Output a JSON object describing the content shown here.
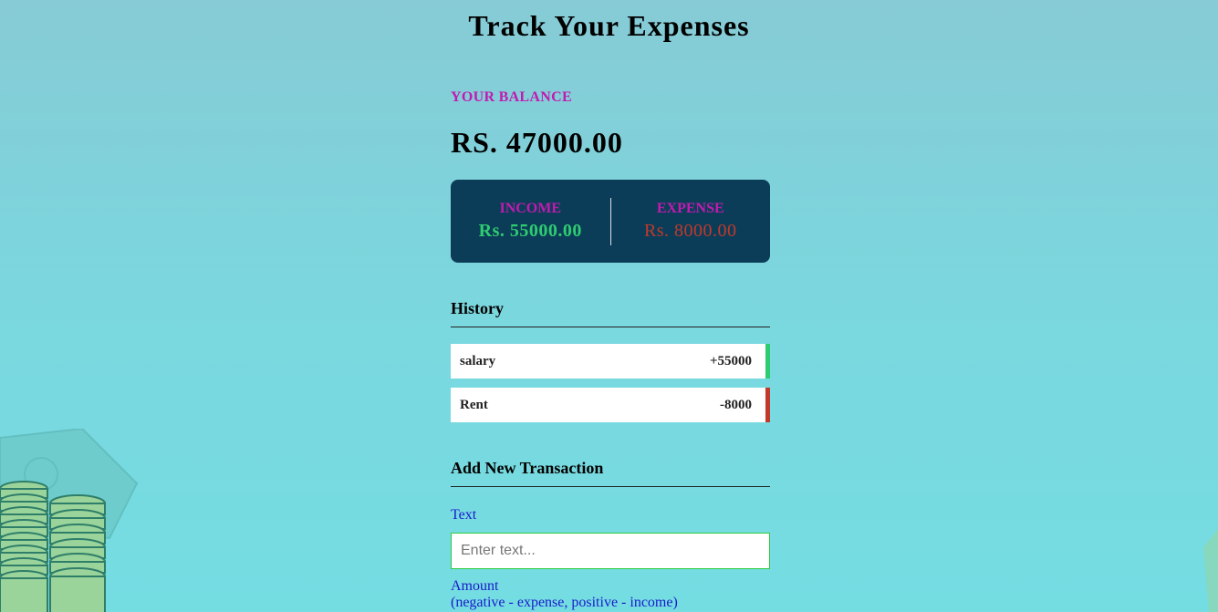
{
  "page": {
    "title": "Track Your Expenses"
  },
  "balance": {
    "label": "YOUR BALANCE",
    "value": "RS. 47000.00"
  },
  "summary": {
    "income_label": "INCOME",
    "income_value": "Rs. 55000.00",
    "expense_label": "EXPENSE",
    "expense_value": "Rs. 8000.00"
  },
  "history": {
    "heading": "History",
    "items": [
      {
        "text": "salary",
        "amount": "+55000",
        "type": "income"
      },
      {
        "text": "Rent",
        "amount": "-8000",
        "type": "expense"
      }
    ]
  },
  "form": {
    "heading": "Add New Transaction",
    "text_label": "Text",
    "text_placeholder": "Enter text...",
    "amount_label": "Amount",
    "amount_hint": "(negative - expense, positive - income)"
  },
  "colors": {
    "accent_label": "#c21ab0",
    "income": "#2ecc71",
    "expense": "#c0392b",
    "card": "#0c3d58"
  }
}
